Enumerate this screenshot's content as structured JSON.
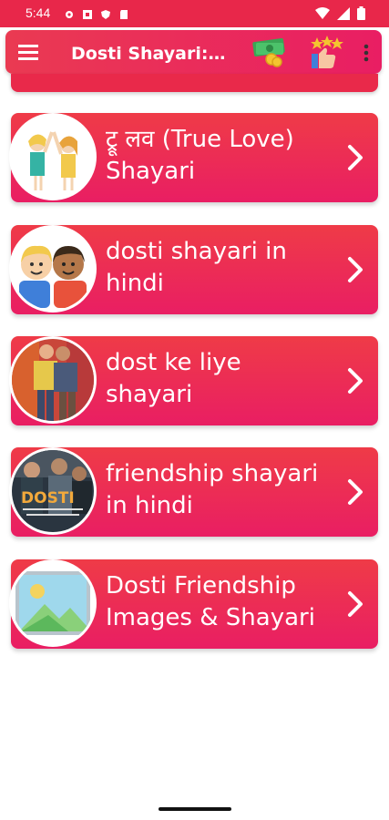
{
  "status_bar": {
    "time": "5:44"
  },
  "app_bar": {
    "title": "Dosti Shayari:दो..."
  },
  "cards": [
    {
      "label": "ट्रू लव (True Love) Shayari"
    },
    {
      "label": "dosti shayari in hindi"
    },
    {
      "label": "dost ke liye shayari"
    },
    {
      "label": "friendship shayari in hindi",
      "image_text": "DOSTI"
    },
    {
      "label": "Dosti Friendship Images & Shayari"
    }
  ],
  "colors": {
    "accent": "#e91e63",
    "accent_alt": "#ef3b47"
  }
}
